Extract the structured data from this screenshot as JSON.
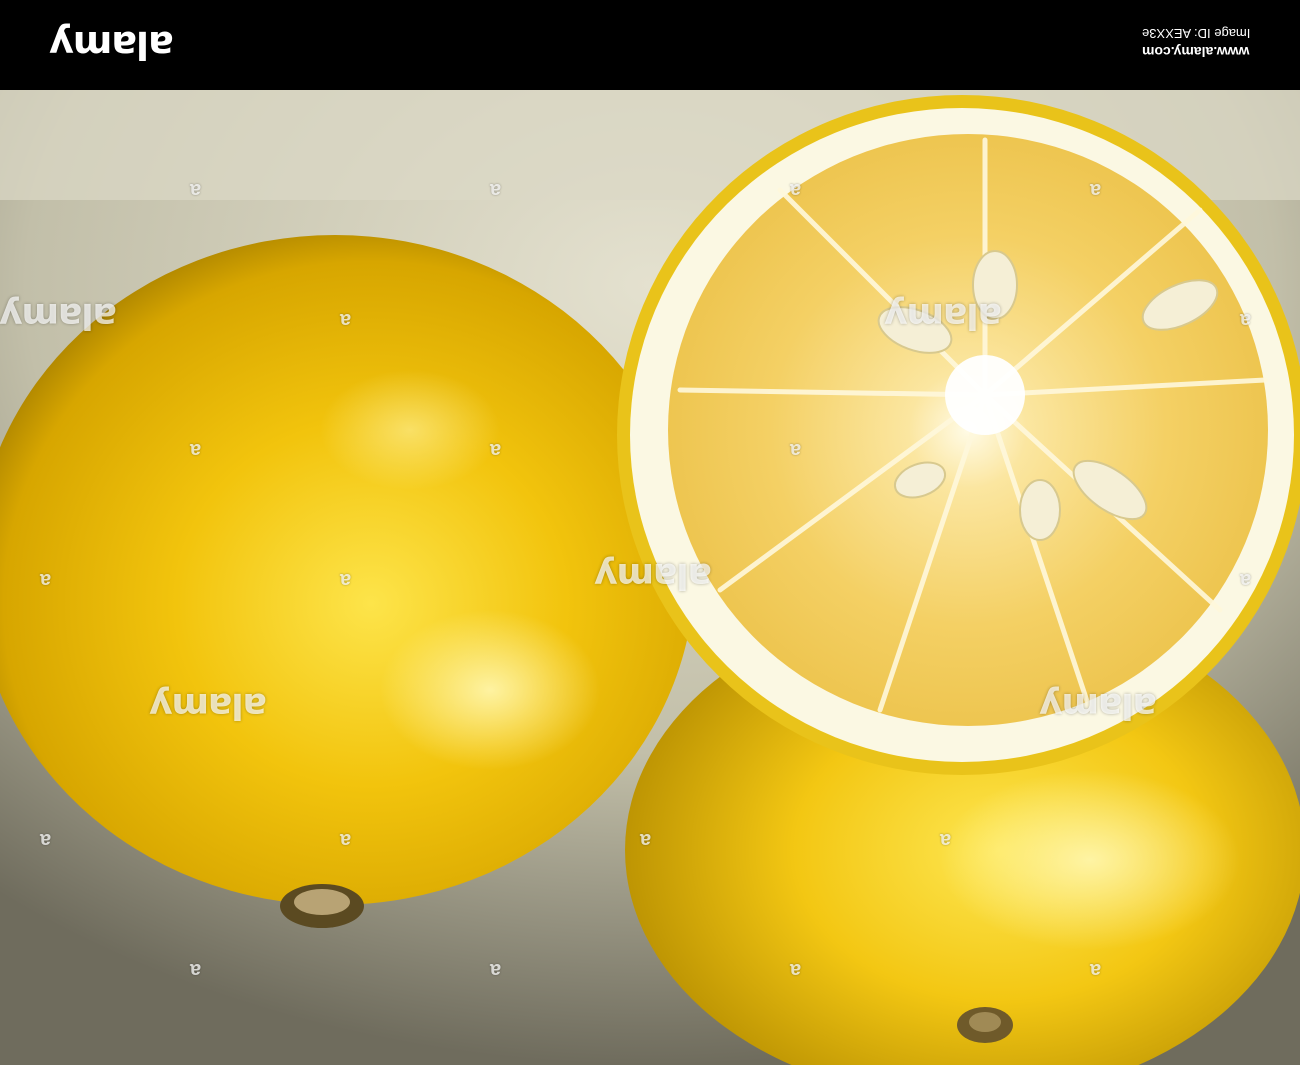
{
  "header": {
    "logo_text": "alamy",
    "image_id": "Image ID: AEXX3e",
    "site_url": "www.alamy.com"
  },
  "photo": {
    "subject": "lemons",
    "watermark_mark": "a",
    "watermark_logo": "alamy",
    "colors": {
      "background": "#c9c6b2",
      "lemon_skin": "#f0c20c",
      "lemon_shadow": "#b88f00",
      "pulp": "#f2d36a",
      "pith": "#fbf8e3"
    }
  }
}
